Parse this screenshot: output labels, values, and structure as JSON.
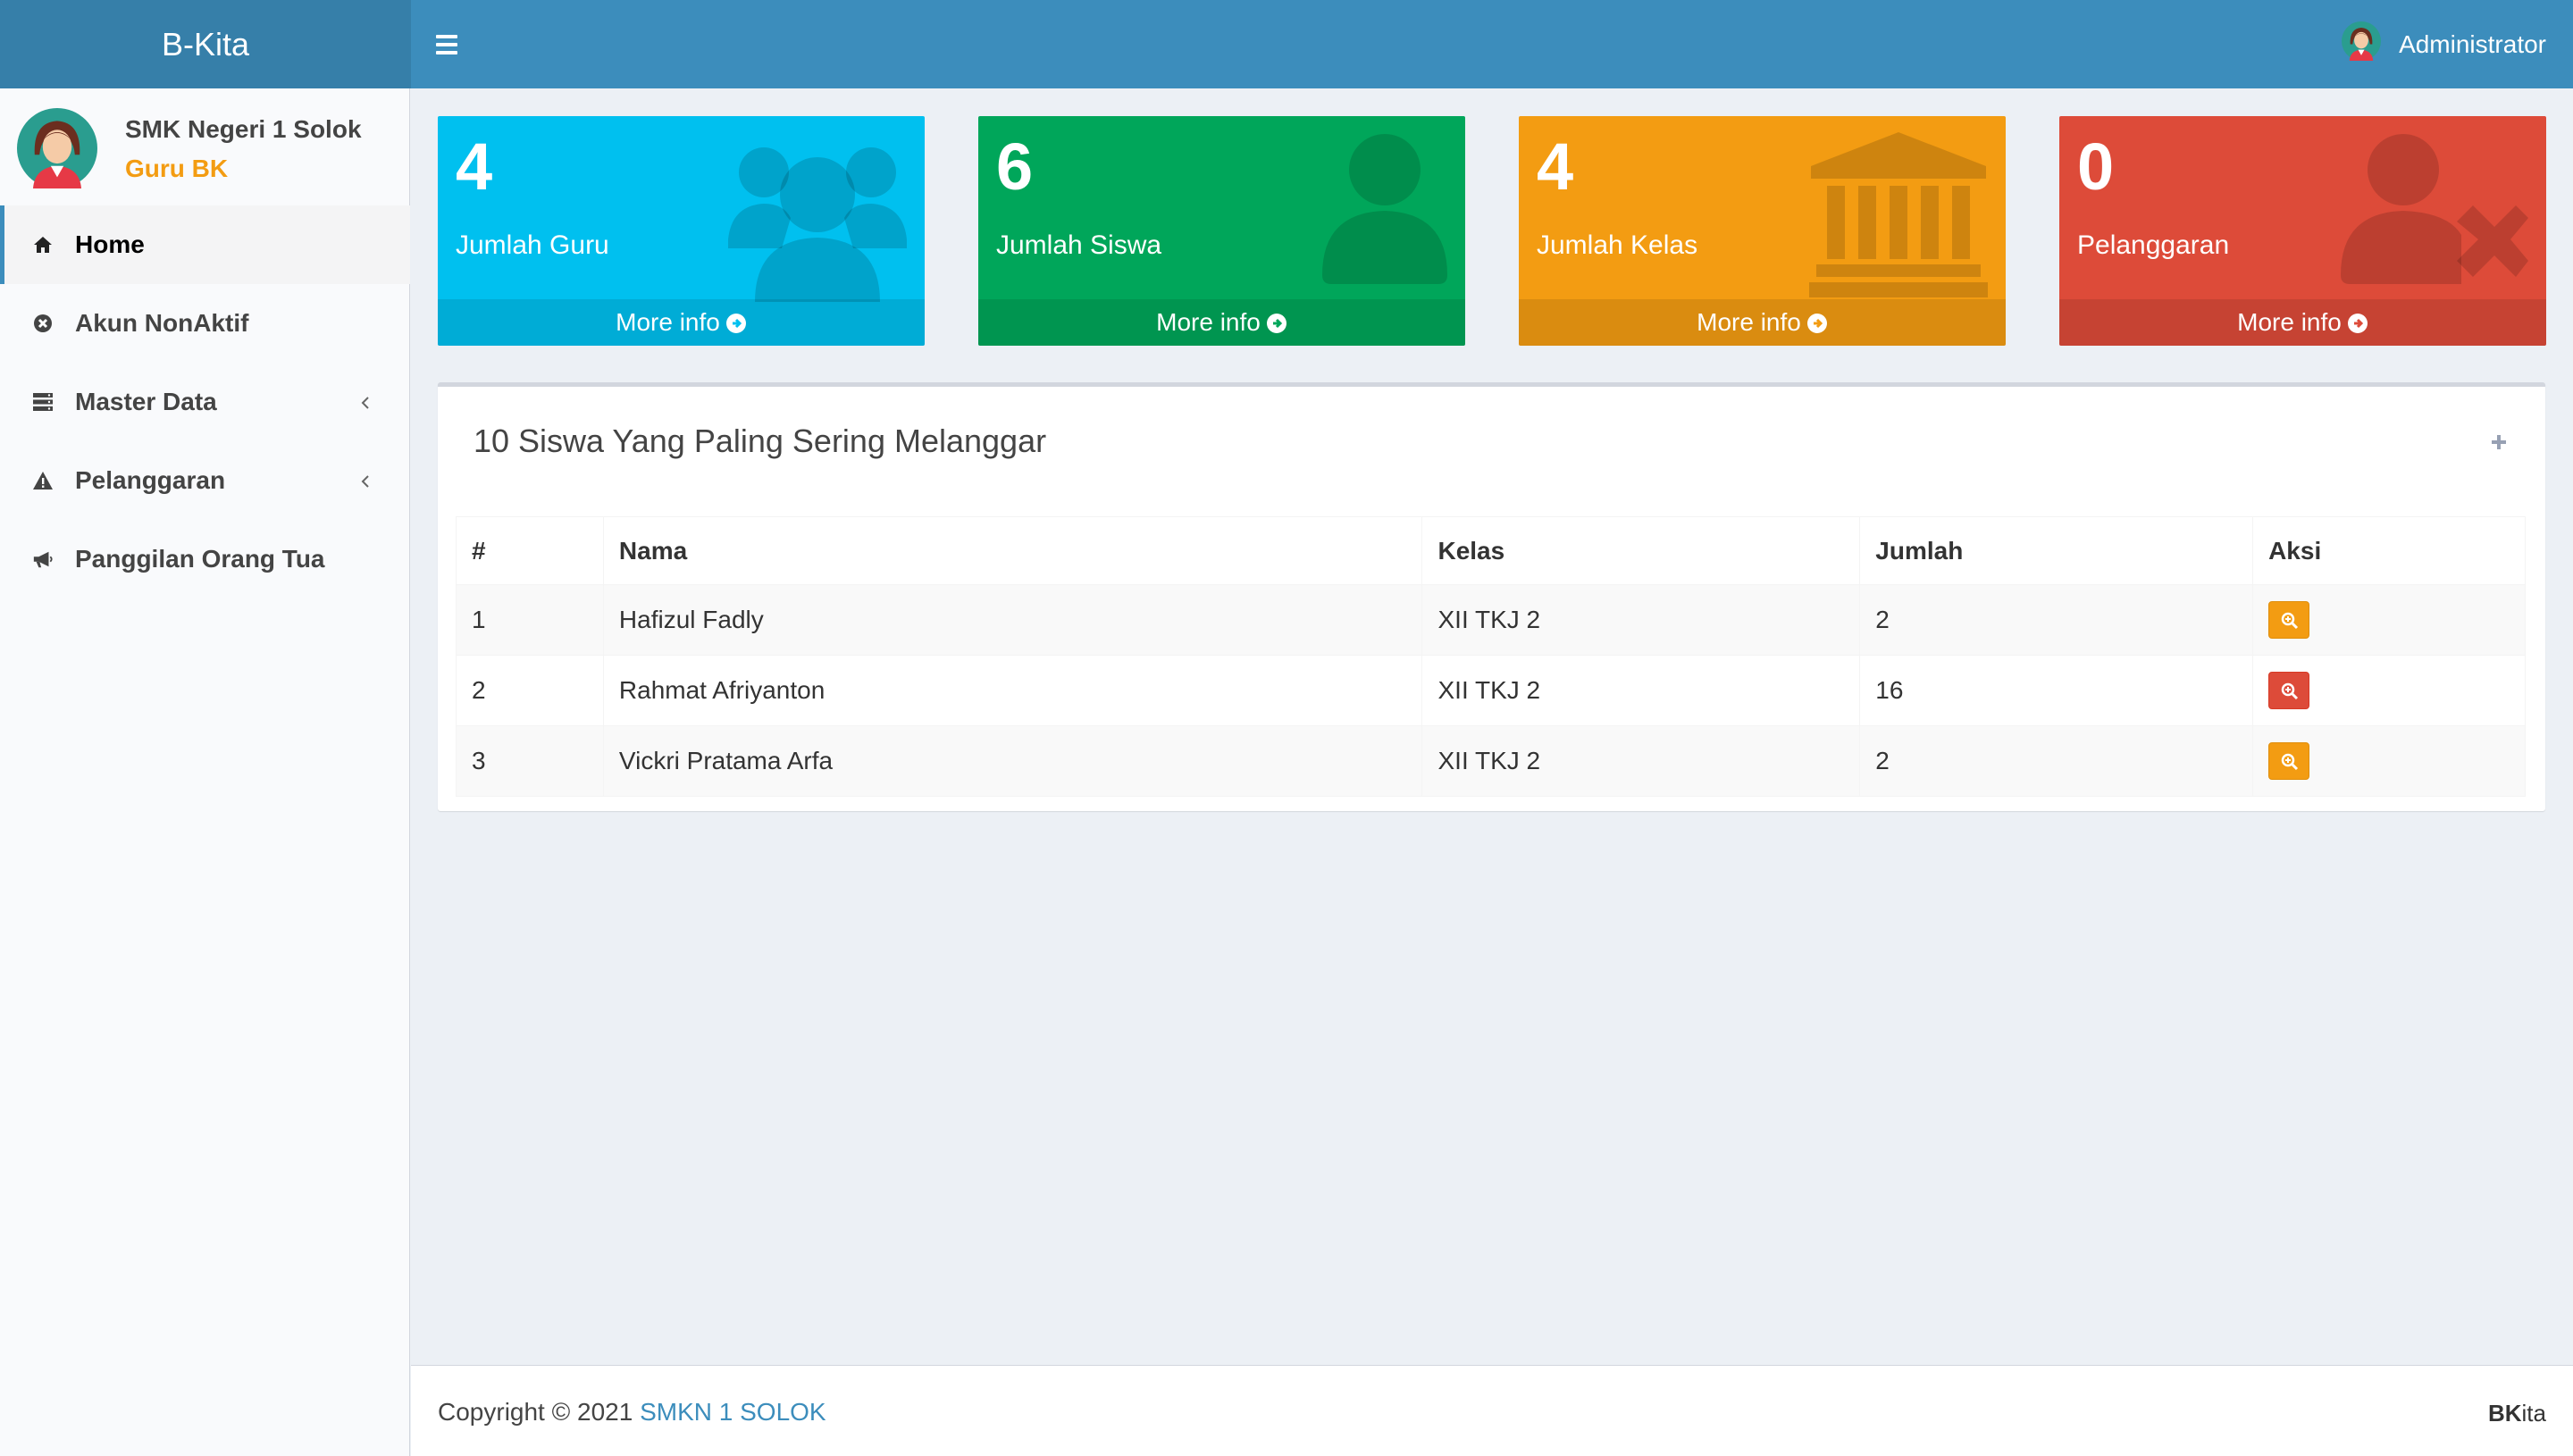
{
  "header": {
    "logo": "B-Kita",
    "user_name": "Administrator"
  },
  "sidebar": {
    "school": "SMK Negeri 1 Solok",
    "role": "Guru BK",
    "items": [
      {
        "label": "Home",
        "icon": "home-icon",
        "active": true
      },
      {
        "label": "Akun NonAktif",
        "icon": "times-circle-icon"
      },
      {
        "label": "Master Data",
        "icon": "server-icon",
        "has_submenu": true
      },
      {
        "label": "Pelanggaran",
        "icon": "warning-icon",
        "has_submenu": true
      },
      {
        "label": "Panggilan Orang Tua",
        "icon": "bullhorn-icon"
      }
    ]
  },
  "stats": [
    {
      "value": "4",
      "label": "Jumlah Guru",
      "more": "More info",
      "color": "#00c0ef",
      "icon": "users-icon"
    },
    {
      "value": "6",
      "label": "Jumlah Siswa",
      "more": "More info",
      "color": "#00a65a",
      "icon": "user-icon"
    },
    {
      "value": "4",
      "label": "Jumlah Kelas",
      "more": "More info",
      "color": "#f39c12",
      "icon": "institution-icon"
    },
    {
      "value": "0",
      "label": "Pelanggaran",
      "more": "More info",
      "color": "#dd4b39",
      "icon": "user-times-icon"
    }
  ],
  "box": {
    "title": "10 Siswa Yang Paling Sering Melanggar",
    "columns": [
      "#",
      "Nama",
      "Kelas",
      "Jumlah",
      "Aksi"
    ],
    "rows": [
      {
        "no": "1",
        "nama": "Hafizul Fadly",
        "kelas": "XII TKJ 2",
        "jumlah": "2",
        "action_color": "#f39c12"
      },
      {
        "no": "2",
        "nama": "Rahmat Afriyanton",
        "kelas": "XII TKJ 2",
        "jumlah": "16",
        "action_color": "#dd4b39"
      },
      {
        "no": "3",
        "nama": "Vickri Pratama Arfa",
        "kelas": "XII TKJ 2",
        "jumlah": "2",
        "action_color": "#f39c12"
      }
    ]
  },
  "footer": {
    "copyright": "Copyright © 2021",
    "link": "SMKN 1 SOLOK",
    "brand_bold": "BK",
    "brand_rest": "ita"
  },
  "colors": {
    "primary": "#3c8dbc",
    "header_logo": "#367fa9",
    "accent_role": "#f39c12"
  }
}
